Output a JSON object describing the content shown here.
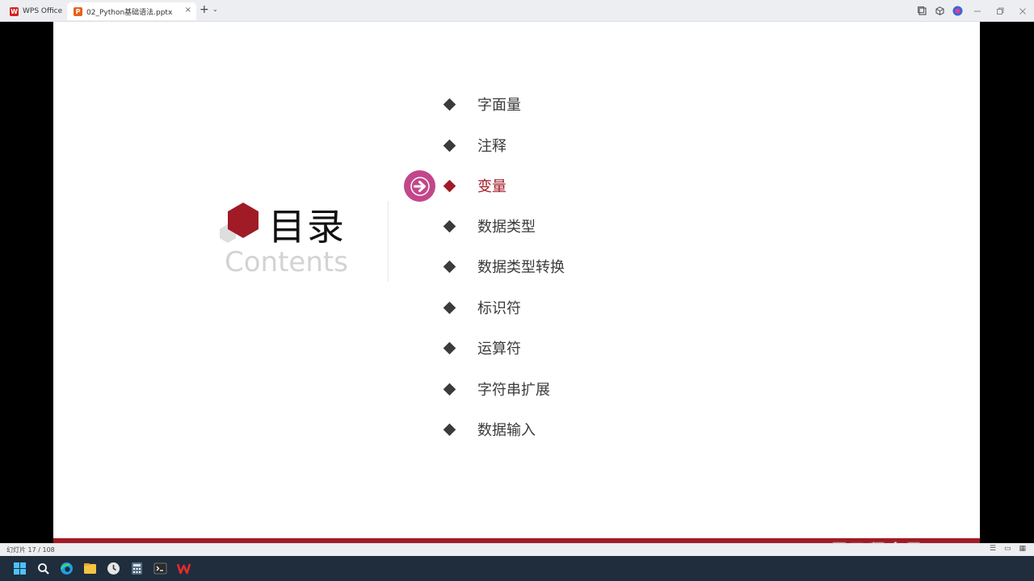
{
  "titlebar": {
    "home_tab": "WPS Office",
    "file_tab": "02_Python基础语法.pptx",
    "close_glyph": "×",
    "add_glyph": "+",
    "chev_glyph": "⌄"
  },
  "slide": {
    "title": "目录",
    "subtitle": "Contents",
    "items": [
      {
        "label": "字面量",
        "active": false
      },
      {
        "label": "注释",
        "active": false
      },
      {
        "label": "变量",
        "active": true
      },
      {
        "label": "数据类型",
        "active": false
      },
      {
        "label": "数据类型转换",
        "active": false
      },
      {
        "label": "标识符",
        "active": false
      },
      {
        "label": "运算符",
        "active": false
      },
      {
        "label": "字符串扩展",
        "active": false
      },
      {
        "label": "数据输入",
        "active": false
      }
    ],
    "watermark": "黑马程序员",
    "accent_color": "#a01b26",
    "arrow_color": "#c2478a"
  },
  "statusbar": {
    "slide_counter": "幻灯片 17 / 108"
  },
  "taskbar": {
    "icons": [
      "windows-start-icon",
      "search-icon",
      "edge-browser-icon",
      "file-explorer-icon",
      "clock-app-icon",
      "calculator-icon",
      "terminal-icon",
      "wps-app-icon"
    ]
  }
}
